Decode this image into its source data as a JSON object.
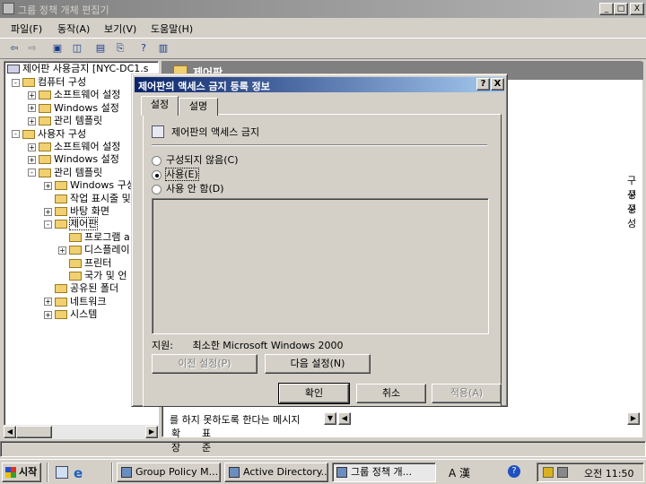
{
  "window": {
    "title": "그룹 정책 개체 편집기",
    "min": "_",
    "max": "□",
    "close": "X"
  },
  "menu": [
    "파일(F)",
    "동작(A)",
    "보기(V)",
    "도움말(H)"
  ],
  "tree": {
    "root": "제어판 사용금지 [NYC-DC1.s",
    "items": [
      {
        "label": "컴퓨터 구성",
        "level": 1,
        "exp": "-"
      },
      {
        "label": "소프트웨어 설정",
        "level": 2,
        "exp": "+"
      },
      {
        "label": "Windows 설정",
        "level": 2,
        "exp": "+"
      },
      {
        "label": "관리 템플릿",
        "level": 2,
        "exp": "+"
      },
      {
        "label": "사용자 구성",
        "level": 1,
        "exp": "-"
      },
      {
        "label": "소프트웨어 설정",
        "level": 2,
        "exp": "+"
      },
      {
        "label": "Windows 설정",
        "level": 2,
        "exp": "+"
      },
      {
        "label": "관리 템플릿",
        "level": 2,
        "exp": "-"
      },
      {
        "label": "Windows 구성",
        "level": 3,
        "exp": "+"
      },
      {
        "label": "작업 표시줄 및",
        "level": 3,
        "exp": ""
      },
      {
        "label": "바탕 화면",
        "level": 3,
        "exp": "+"
      },
      {
        "label": "제어판",
        "level": 3,
        "exp": "-"
      },
      {
        "label": "프로그램 a",
        "level": 4,
        "exp": ""
      },
      {
        "label": "디스플레이",
        "level": 4,
        "exp": "+"
      },
      {
        "label": "프린터",
        "level": 4,
        "exp": ""
      },
      {
        "label": "국가 및 언",
        "level": 4,
        "exp": ""
      },
      {
        "label": "공유된 폴더",
        "level": 3,
        "exp": ""
      },
      {
        "label": "네트워크",
        "level": 3,
        "exp": "+"
      },
      {
        "label": "시스템",
        "level": 3,
        "exp": "+"
      }
    ]
  },
  "right_panel": {
    "header": "제어판",
    "col_fragments": [
      "구성",
      "구성",
      "구성"
    ],
    "bottom_text_1": "를 하지 못하도록 한다는 메시지"
  },
  "bottom_tabs": [
    "확장",
    "표준"
  ],
  "dialog": {
    "title": "제어판의 액세스 금지 등록 정보",
    "help_btn": "?",
    "close_btn": "X",
    "tabs": [
      "설정",
      "설명"
    ],
    "policy_name": "제어판의 액세스 금지",
    "options": [
      {
        "label": "구성되지 않음(C)",
        "selected": false
      },
      {
        "label": "사용(E)",
        "selected": true
      },
      {
        "label": "사용 안 함(D)",
        "selected": false
      }
    ],
    "support_label": "지원:",
    "support_value": "최소한 Microsoft Windows 2000",
    "prev_btn": "이전 설정(P)",
    "next_btn": "다음 설정(N)",
    "ok_btn": "확인",
    "cancel_btn": "취소",
    "apply_btn": "적용(A)"
  },
  "taskbar": {
    "start": "시작",
    "tasks": [
      "Group Policy M...",
      "Active Directory...",
      "그룹 정책 개..."
    ],
    "ime": "A 漢",
    "clock": "오전 11:50"
  }
}
